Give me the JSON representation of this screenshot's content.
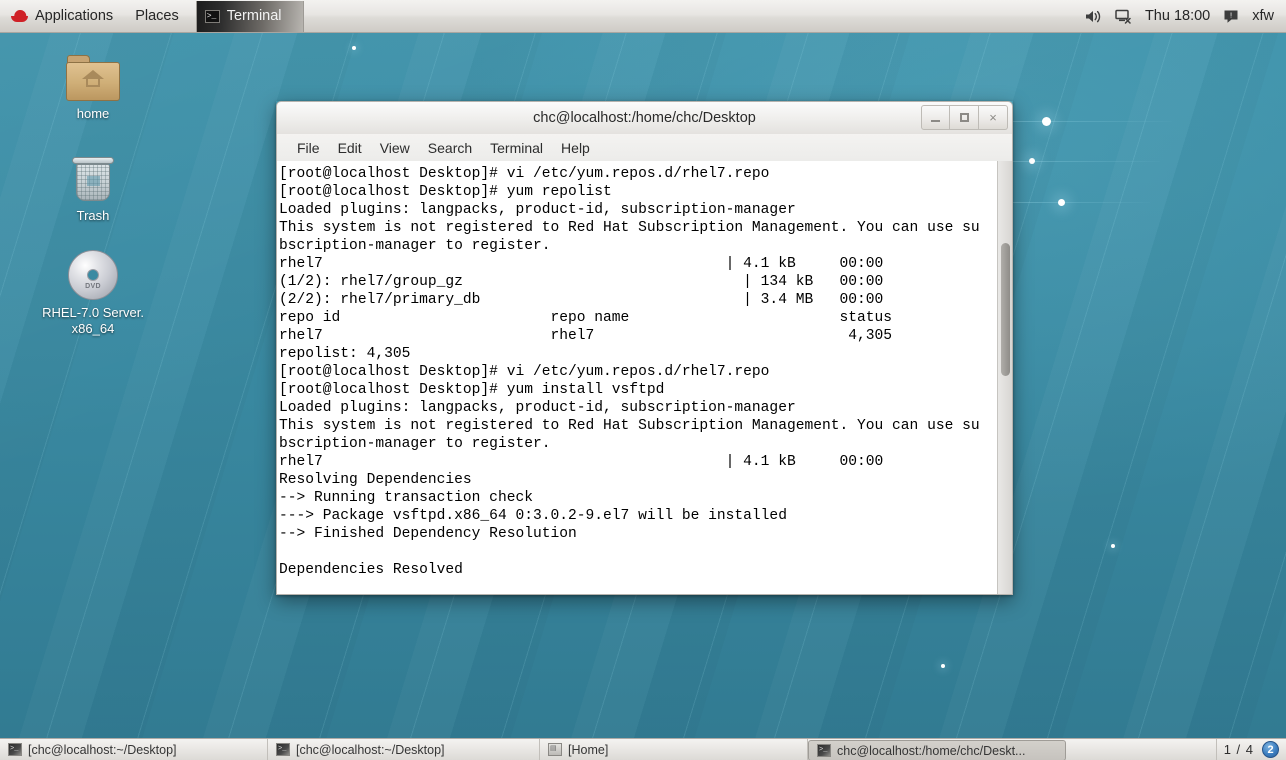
{
  "top_panel": {
    "logo_icon": "redhat-logo-icon",
    "applications_label": "Applications",
    "places_label": "Places",
    "window_entry": {
      "label": "Terminal",
      "icon": "terminal-icon"
    },
    "tray": {
      "volume_icon": "speaker-icon",
      "network_icon": "network-disconnected-icon",
      "clock": "Thu 18:00",
      "message_icon": "message-icon",
      "user_label": "xfw"
    }
  },
  "desktop_icons": [
    {
      "name": "home",
      "label": "home",
      "icon": "home-folder-icon"
    },
    {
      "name": "trash",
      "label": "Trash",
      "icon": "trash-icon"
    },
    {
      "name": "dvd",
      "label": "RHEL-7.0 Server.\nx86_64",
      "label_line1": "RHEL-7.0 Server.",
      "label_line2": "x86_64",
      "icon": "dvd-disc-icon",
      "disc_text": "DVD"
    }
  ],
  "terminal": {
    "title": "chc@localhost:/home/chc/Desktop",
    "window_buttons": {
      "minimize": "minimize-icon",
      "maximize": "maximize-icon",
      "close": "×"
    },
    "menu": [
      "File",
      "Edit",
      "View",
      "Search",
      "Terminal",
      "Help"
    ],
    "lines": [
      "[root@localhost Desktop]# vi /etc/yum.repos.d/rhel7.repo",
      "[root@localhost Desktop]# yum repolist",
      "Loaded plugins: langpacks, product-id, subscription-manager",
      "This system is not registered to Red Hat Subscription Management. You can use su",
      "bscription-manager to register.",
      "rhel7                                              | 4.1 kB     00:00",
      "(1/2): rhel7/group_gz                                | 134 kB   00:00",
      "(2/2): rhel7/primary_db                              | 3.4 MB   00:00",
      "repo id                        repo name                        status",
      "rhel7                          rhel7                             4,305",
      "repolist: 4,305",
      "[root@localhost Desktop]# vi /etc/yum.repos.d/rhel7.repo",
      "[root@localhost Desktop]# yum install vsftpd",
      "Loaded plugins: langpacks, product-id, subscription-manager",
      "This system is not registered to Red Hat Subscription Management. You can use su",
      "bscription-manager to register.",
      "rhel7                                              | 4.1 kB     00:00",
      "Resolving Dependencies",
      "--> Running transaction check",
      "---> Package vsftpd.x86_64 0:3.0.2-9.el7 will be installed",
      "--> Finished Dependency Resolution",
      "",
      "Dependencies Resolved"
    ]
  },
  "taskbar": {
    "items": [
      {
        "label": "[chc@localhost:~/Desktop]",
        "icon": "terminal-icon",
        "active": false
      },
      {
        "label": "[chc@localhost:~/Desktop]",
        "icon": "terminal-icon",
        "active": false
      },
      {
        "label": "[Home]",
        "icon": "file-manager-icon",
        "active": false
      },
      {
        "label": "chc@localhost:/home/chc/Deskt...",
        "icon": "terminal-icon",
        "active": true
      }
    ],
    "workspace_count": "1 / 4",
    "workspace_badge": "2"
  },
  "colors": {
    "desktop": "#3a8aa2",
    "panel": "#e7e5e2",
    "terminal_bg": "#ffffff",
    "terminal_fg": "#000000",
    "accent_red": "#cf2127",
    "badge_blue": "#3d7fc1"
  }
}
